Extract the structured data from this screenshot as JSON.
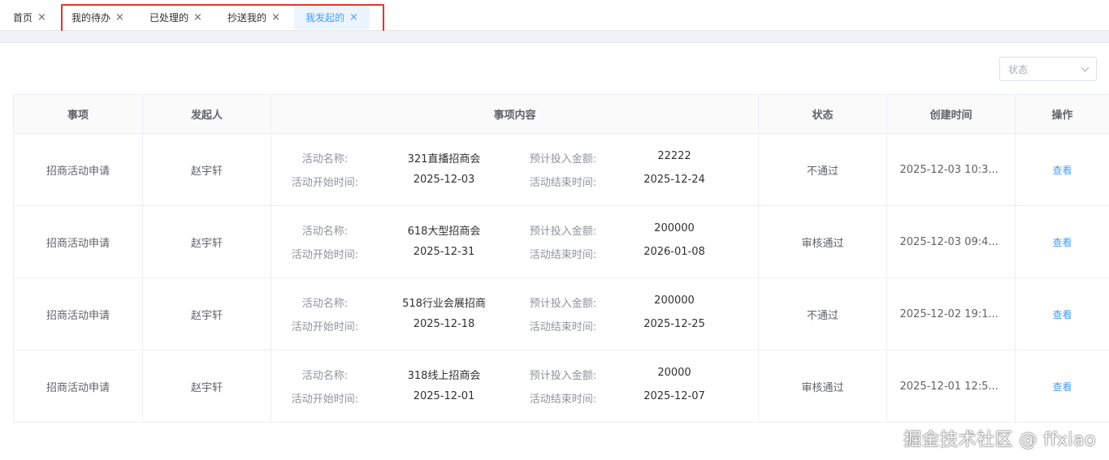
{
  "tabs": [
    {
      "label": "首页",
      "active": false
    },
    {
      "label": "我的待办",
      "active": false
    },
    {
      "label": "已处理的",
      "active": false
    },
    {
      "label": "抄送我的",
      "active": false
    },
    {
      "label": "我发起的",
      "active": true
    }
  ],
  "filter": {
    "status_placeholder": "状态"
  },
  "table": {
    "headers": [
      "事项",
      "发起人",
      "事项内容",
      "状态",
      "创建时间",
      "操作"
    ],
    "field_labels": {
      "name": "活动名称:",
      "budget": "预计投入金额:",
      "start": "活动开始时间:",
      "end": "活动结束时间:"
    },
    "rows": [
      {
        "item": "招商活动申请",
        "initiator": "赵宇轩",
        "name": "321直播招商会",
        "budget": "22222",
        "start": "2025-12-03",
        "end": "2025-12-24",
        "status": "不通过",
        "created": "2025-12-03 10:3...",
        "action": "查看"
      },
      {
        "item": "招商活动申请",
        "initiator": "赵宇轩",
        "name": "618大型招商会",
        "budget": "200000",
        "start": "2025-12-31",
        "end": "2026-01-08",
        "status": "审核通过",
        "created": "2025-12-03 09:4...",
        "action": "查看"
      },
      {
        "item": "招商活动申请",
        "initiator": "赵宇轩",
        "name": "518行业会展招商",
        "budget": "200000",
        "start": "2025-12-18",
        "end": "2025-12-25",
        "status": "不通过",
        "created": "2025-12-02 19:1...",
        "action": "查看"
      },
      {
        "item": "招商活动申请",
        "initiator": "赵宇轩",
        "name": "318线上招商会",
        "budget": "20000",
        "start": "2025-12-01",
        "end": "2025-12-07",
        "status": "审核通过",
        "created": "2025-12-01 12:5...",
        "action": "查看"
      }
    ]
  },
  "watermark": "掘金技术社区 @ ffxiao",
  "colors": {
    "accent": "#409eff",
    "highlight_border": "#e8322b"
  }
}
